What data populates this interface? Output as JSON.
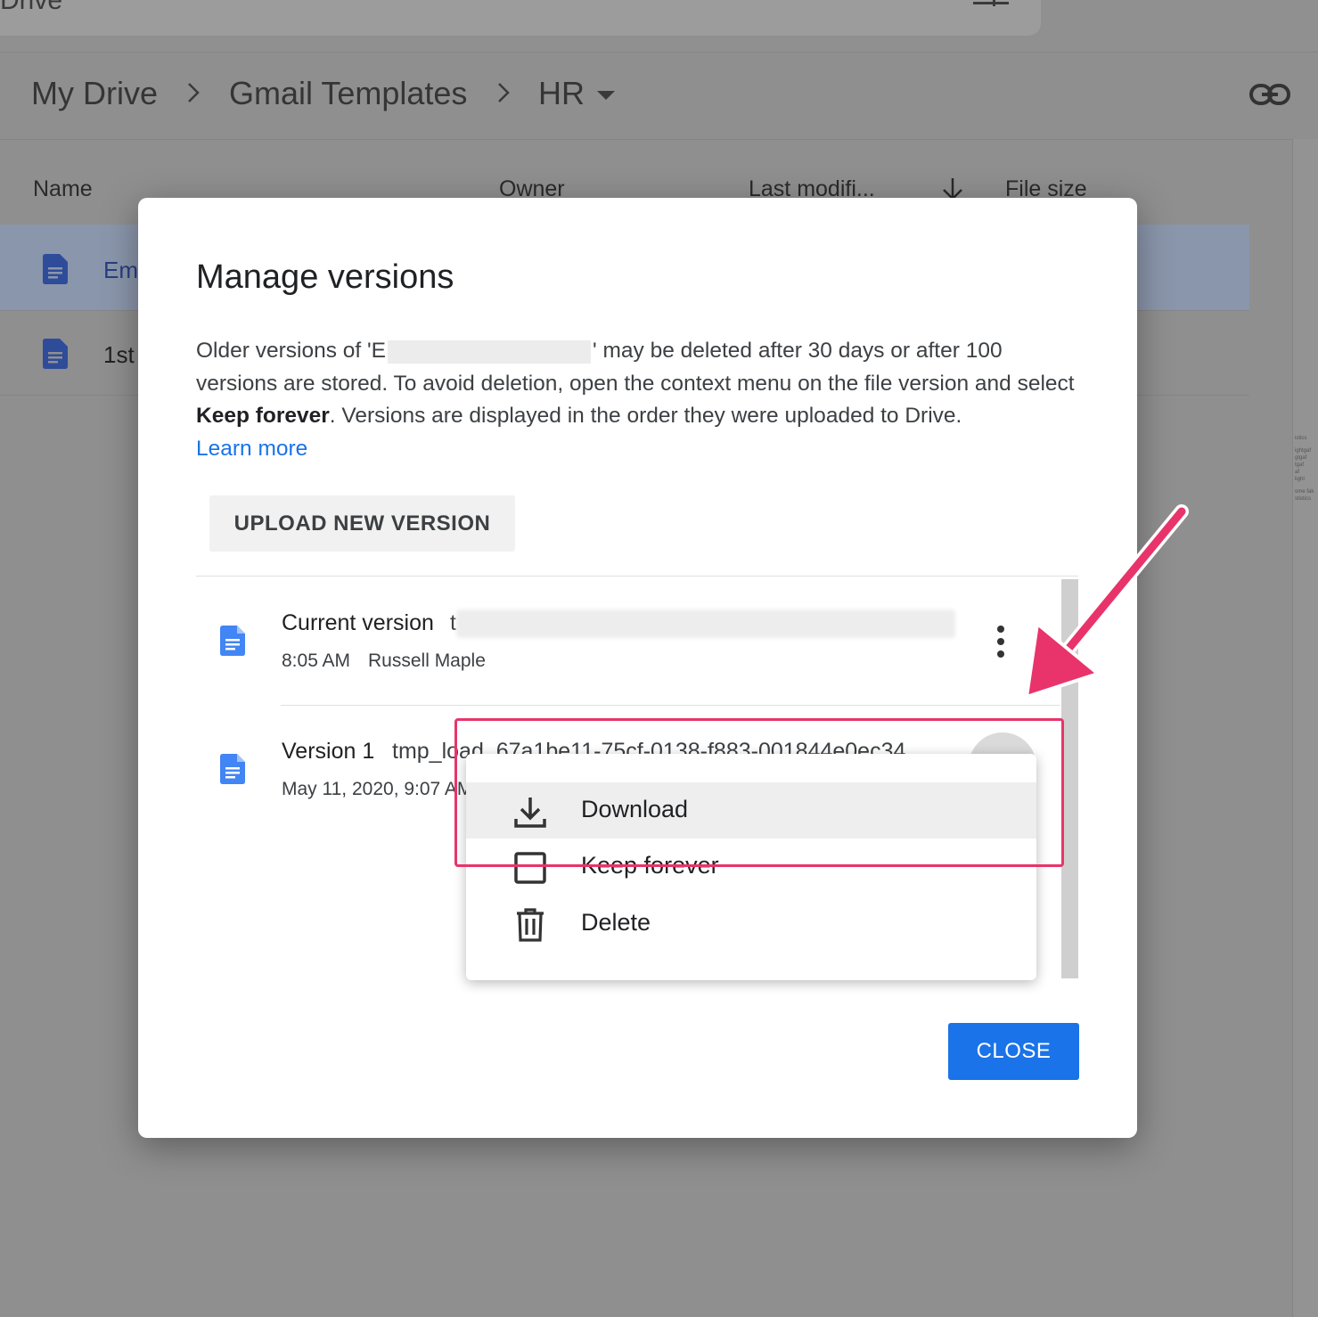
{
  "app": {
    "title": "Drive"
  },
  "breadcrumb": {
    "items": [
      "My Drive",
      "Gmail Templates",
      "HR"
    ]
  },
  "file_list": {
    "columns": [
      "Name",
      "Owner",
      "Last modifi...",
      "File size"
    ],
    "rows": [
      {
        "name": "Em"
      },
      {
        "name": "1st"
      }
    ]
  },
  "right_panel": {
    "lines": [
      "istics",
      "ightgaf",
      "gtgaf",
      "tgaf",
      "af",
      "light",
      "ome fak",
      "stistics"
    ]
  },
  "dialog": {
    "title": "Manage versions",
    "desc_part1": "Older versions of 'E",
    "desc_part2": "' may be deleted after 30 days or after 100 versions are stored. To avoid deletion, open the context menu on the file version and select ",
    "desc_bold": "Keep forever",
    "desc_part3": ". Versions are displayed in the order they were uploaded to Drive.",
    "learn_more": "Learn more",
    "upload_button": "UPLOAD NEW VERSION",
    "versions": [
      {
        "label": "Current version",
        "name": "t",
        "time": "8:05 AM",
        "author": "Russell Maple"
      },
      {
        "label": "Version 1",
        "name": "tmp_load_67a1be11-75cf-0138-f883-001844e0ec34",
        "time": "May 11, 2020, 9:07 AM"
      }
    ],
    "close_button": "CLOSE"
  },
  "context_menu": {
    "items": [
      {
        "label": "Download",
        "icon": "download-icon",
        "highlighted": true
      },
      {
        "label": "Keep forever",
        "icon": "checkbox-icon",
        "highlighted": false
      },
      {
        "label": "Delete",
        "icon": "trash-icon",
        "highlighted": false
      }
    ]
  },
  "colors": {
    "accent": "#1a73e8",
    "annotation": "#e8346b",
    "doc_icon": "#4285f4"
  }
}
